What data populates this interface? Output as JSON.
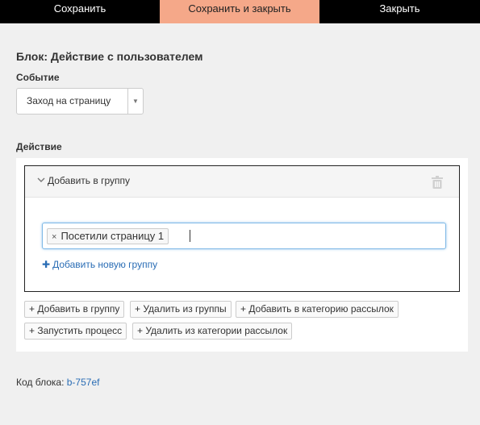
{
  "toolbar": {
    "save_label": "Сохранить",
    "save_close_label": "Сохранить и закрыть",
    "close_label": "Закрыть"
  },
  "block": {
    "title": "Блок: Действие с пользователем",
    "event_label": "Событие",
    "event_value": "Заход на страницу",
    "action_label": "Действие"
  },
  "action": {
    "title": "Добавить в группу",
    "tags": [
      "Посетили страницу 1"
    ],
    "tag_remove_symbol": "×",
    "add_new_group_label": "Добавить новую группу"
  },
  "action_buttons": [
    "+ Добавить в группу",
    "+ Удалить из группы",
    "+ Добавить в категорию рассылок",
    "+ Запустить процесс",
    "+ Удалить из категории рассылок"
  ],
  "footer": {
    "code_label": "Код блока:",
    "code_value": "b-757ef"
  },
  "icons": {
    "collapse": "chevron-down-icon",
    "delete": "trash-icon",
    "add": "plus-icon",
    "dropdown": "caret-down-icon"
  },
  "colors": {
    "accent_tab": "#f5a889",
    "link": "#2a6db5",
    "focus_border": "#7fb9e6"
  }
}
